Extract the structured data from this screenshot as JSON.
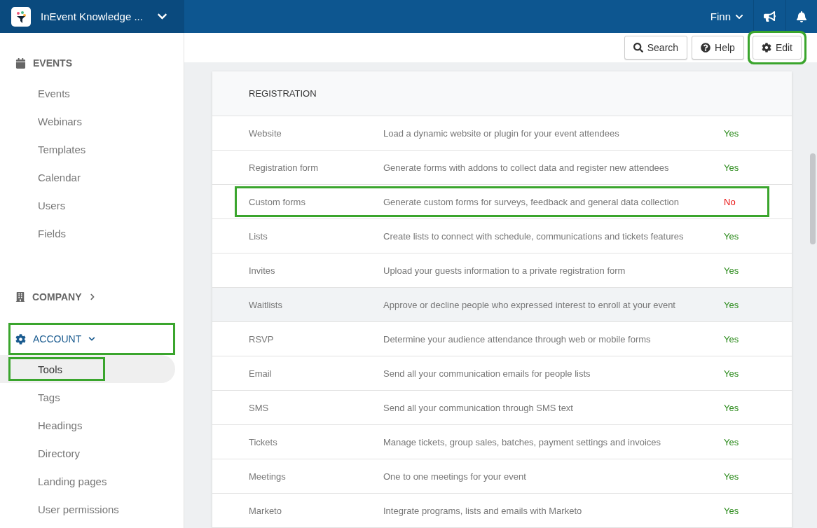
{
  "topbar": {
    "title": "InEvent Knowledge ...",
    "user": "Finn"
  },
  "toolbar": {
    "buttons": [
      {
        "kind": "search",
        "label": "Search",
        "highlighted": false
      },
      {
        "kind": "help",
        "label": "Help",
        "highlighted": false
      },
      {
        "kind": "edit",
        "label": "Edit",
        "highlighted": true
      }
    ]
  },
  "sidebar": {
    "sections": [
      {
        "kind": "events",
        "label": "EVENTS",
        "highlighted": false,
        "items": [
          {
            "label": "Events",
            "selected": false,
            "highlighted": false
          },
          {
            "label": "Webinars",
            "selected": false,
            "highlighted": false
          },
          {
            "label": "Templates",
            "selected": false,
            "highlighted": false
          },
          {
            "label": "Calendar",
            "selected": false,
            "highlighted": false
          },
          {
            "label": "Users",
            "selected": false,
            "highlighted": false
          },
          {
            "label": "Fields",
            "selected": false,
            "highlighted": false
          }
        ]
      },
      {
        "kind": "company",
        "label": "COMPANY",
        "expanded": false,
        "highlighted": false
      },
      {
        "kind": "account",
        "label": "ACCOUNT",
        "expanded": true,
        "highlighted": true,
        "items": [
          {
            "label": "Tools",
            "selected": true,
            "highlighted": true
          },
          {
            "label": "Tags",
            "selected": false,
            "highlighted": false
          },
          {
            "label": "Headings",
            "selected": false,
            "highlighted": false
          },
          {
            "label": "Directory",
            "selected": false,
            "highlighted": false
          },
          {
            "label": "Landing pages",
            "selected": false,
            "highlighted": false
          },
          {
            "label": "User permissions",
            "selected": false,
            "highlighted": false
          }
        ]
      }
    ]
  },
  "table": {
    "heading": "REGISTRATION",
    "rows": [
      {
        "name": "Website",
        "description": "Load a dynamic website or plugin for your event attendees",
        "status": "Yes",
        "enabled": true,
        "highlighted": false,
        "shaded": false
      },
      {
        "name": "Registration form",
        "description": "Generate forms with addons to collect data and register new attendees",
        "status": "Yes",
        "enabled": true,
        "highlighted": false,
        "shaded": false
      },
      {
        "name": "Custom forms",
        "description": "Generate custom forms for surveys, feedback and general data collection",
        "status": "No",
        "enabled": false,
        "highlighted": true,
        "shaded": false
      },
      {
        "name": "Lists",
        "description": "Create lists to connect with schedule, communications and tickets features",
        "status": "Yes",
        "enabled": true,
        "highlighted": false,
        "shaded": false
      },
      {
        "name": "Invites",
        "description": "Upload your guests information to a private registration form",
        "status": "Yes",
        "enabled": true,
        "highlighted": false,
        "shaded": false
      },
      {
        "name": "Waitlists",
        "description": "Approve or decline people who expressed interest to enroll at your event",
        "status": "Yes",
        "enabled": true,
        "highlighted": false,
        "shaded": true
      },
      {
        "name": "RSVP",
        "description": "Determine your audience attendance through web or mobile forms",
        "status": "Yes",
        "enabled": true,
        "highlighted": false,
        "shaded": false
      },
      {
        "name": "Email",
        "description": "Send all your communication emails for people lists",
        "status": "Yes",
        "enabled": true,
        "highlighted": false,
        "shaded": false
      },
      {
        "name": "SMS",
        "description": "Send all your communication through SMS text",
        "status": "Yes",
        "enabled": true,
        "highlighted": false,
        "shaded": false
      },
      {
        "name": "Tickets",
        "description": "Manage tickets, group sales, batches, payment settings and invoices",
        "status": "Yes",
        "enabled": true,
        "highlighted": false,
        "shaded": false
      },
      {
        "name": "Meetings",
        "description": "One to one meetings for your event",
        "status": "Yes",
        "enabled": true,
        "highlighted": false,
        "shaded": false
      },
      {
        "name": "Marketo",
        "description": "Integrate programs, lists and emails with Marketo",
        "status": "Yes",
        "enabled": true,
        "highlighted": false,
        "shaded": false
      }
    ]
  }
}
